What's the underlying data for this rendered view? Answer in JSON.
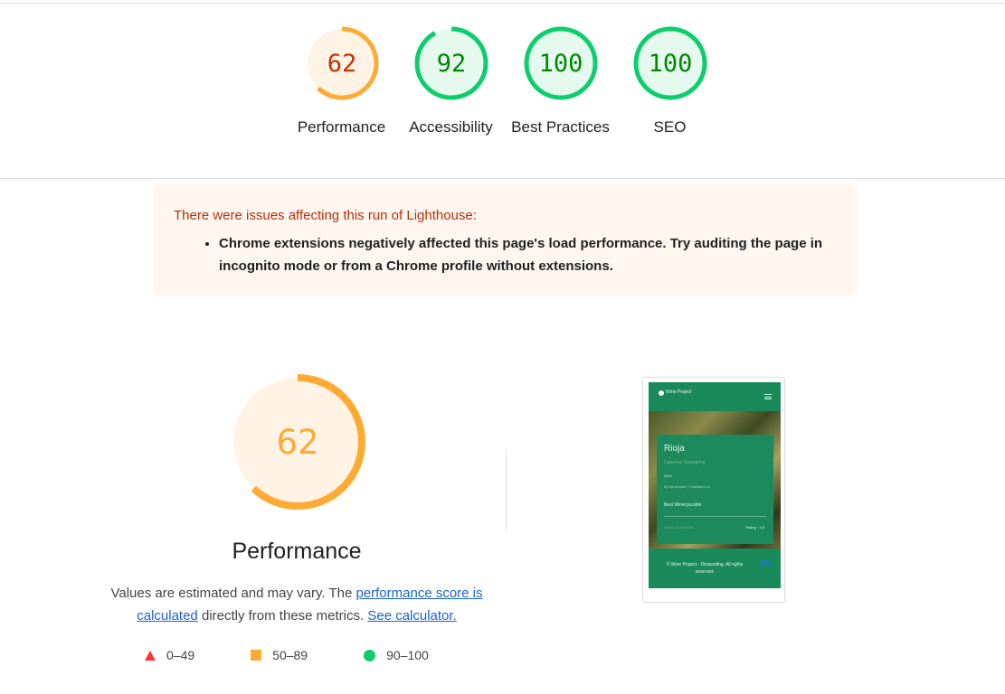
{
  "colors": {
    "fail": "#ff3333",
    "average": "#ffaa33",
    "pass": "#0cce6b",
    "average_text": "#c33300",
    "pass_text": "#008800",
    "warning_title": "#b3310b",
    "link": "#1a63c8"
  },
  "category_gauges": [
    {
      "score": "62",
      "label": "Performance",
      "rating": "average",
      "fraction": 0.62
    },
    {
      "score": "92",
      "label": "Accessibility",
      "rating": "pass",
      "fraction": 0.92
    },
    {
      "score": "100",
      "label": "Best Practices",
      "rating": "pass",
      "fraction": 1.0
    },
    {
      "score": "100",
      "label": "SEO",
      "rating": "pass",
      "fraction": 1.0
    }
  ],
  "warning": {
    "title": "There were issues affecting this run of Lighthouse:",
    "items": [
      "Chrome extensions negatively affected this page's load performance. Try auditing the page in incognito mode or from a Chrome profile without extensions."
    ]
  },
  "performance": {
    "score": "62",
    "fraction": 0.62,
    "title": "Performance",
    "description_prefix": "Values are estimated and may vary. The ",
    "score_link": "performance score is calculated",
    "description_middle": " directly from these metrics.",
    "calculator_link": "See calculator."
  },
  "legend": [
    {
      "icon": "fail-triangle-icon",
      "range": "0–49"
    },
    {
      "icon": "average-square-icon",
      "range": "50–89"
    },
    {
      "icon": "pass-circle-icon",
      "range": "90–100"
    }
  ],
  "screenshot": {
    "logo_text": "Wine Project",
    "card_title": "Rioja",
    "card_subtitle": "Cabernet Sauvignon",
    "card_year": "2014",
    "card_meta": "By Winecoder | Published on",
    "card_tag": "Best Wineryscoble",
    "card_left": "Winery Enthusiast",
    "card_right": "Rating · 3.8",
    "footer": "© Wine Project - Dinacoding. All rights reserved."
  }
}
